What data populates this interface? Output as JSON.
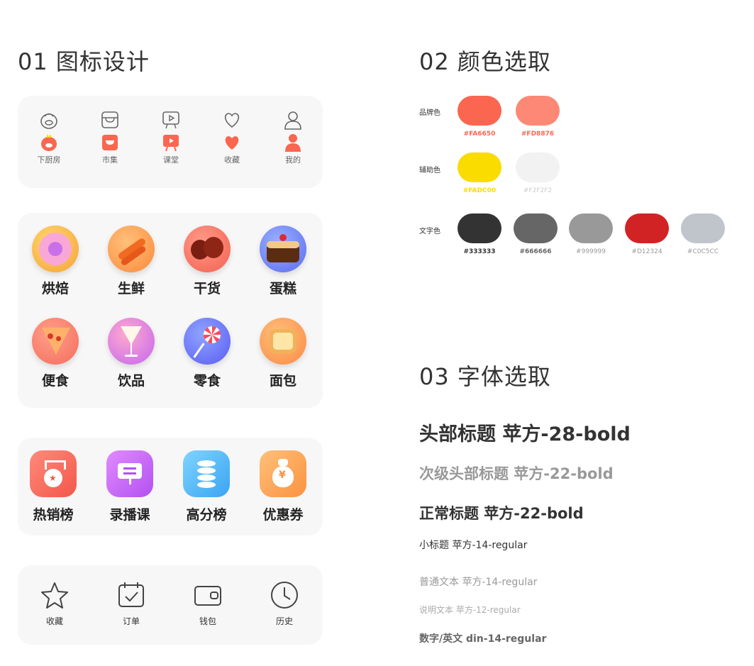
{
  "sections": {
    "icon_design": "01 图标设计",
    "color_pick": "02  颜色选取",
    "font_pick": "03 字体选取"
  },
  "tabbar": {
    "items": [
      {
        "label": "下厨房",
        "icon": "chef-icon"
      },
      {
        "label": "市集",
        "icon": "market-icon"
      },
      {
        "label": "课堂",
        "icon": "classroom-icon"
      },
      {
        "label": "收藏",
        "icon": "heart-icon"
      },
      {
        "label": "我的",
        "icon": "user-icon"
      }
    ],
    "outline_color": "#666666",
    "active_color": "#FA6650"
  },
  "categories": [
    {
      "label": "烘焙",
      "icon": "donut-icon"
    },
    {
      "label": "生鲜",
      "icon": "carrot-icon"
    },
    {
      "label": "干货",
      "icon": "chestnut-icon"
    },
    {
      "label": "蛋糕",
      "icon": "cake-icon"
    },
    {
      "label": "便食",
      "icon": "pizza-icon"
    },
    {
      "label": "饮品",
      "icon": "drink-icon"
    },
    {
      "label": "零食",
      "icon": "lollipop-icon"
    },
    {
      "label": "面包",
      "icon": "bread-icon"
    }
  ],
  "ranks": [
    {
      "label": "热销榜",
      "icon": "medal-icon"
    },
    {
      "label": "录播课",
      "icon": "screen-icon"
    },
    {
      "label": "高分榜",
      "icon": "coins-icon"
    },
    {
      "label": "优惠券",
      "icon": "moneybag-icon"
    }
  ],
  "utilities": [
    {
      "label": "收藏",
      "icon": "star-icon"
    },
    {
      "label": "订单",
      "icon": "calendar-check-icon"
    },
    {
      "label": "钱包",
      "icon": "wallet-icon"
    },
    {
      "label": "历史",
      "icon": "clock-icon"
    }
  ],
  "colors": {
    "brand": {
      "label": "品牌色",
      "swatches": [
        "#FA6650",
        "#FD8876"
      ]
    },
    "aux": {
      "label": "辅助色",
      "swatches": [
        "#FADC00",
        "#F2F2F2"
      ]
    },
    "text": {
      "label": "文字色",
      "swatches": [
        "#333333",
        "#666666",
        "#999999",
        "#D12324",
        "#C0C5CC"
      ]
    }
  },
  "fonts": [
    {
      "text": "头部标题 苹方-28-bold",
      "color": "#333333"
    },
    {
      "text": "次级头部标题 苹方-22-bold",
      "color": "#999999"
    },
    {
      "text": "正常标题 苹方-22-bold",
      "color": "#333333"
    },
    {
      "text": "小标题 苹方-14-regular",
      "color": "#333333"
    },
    {
      "text": "普通文本 苹方-14-regular",
      "color": "#999999"
    },
    {
      "text": "说明文本 苹方-12-regular",
      "color": "#999999"
    },
    {
      "text": "数字/英文 din-14-regular",
      "color": "#666666"
    }
  ]
}
